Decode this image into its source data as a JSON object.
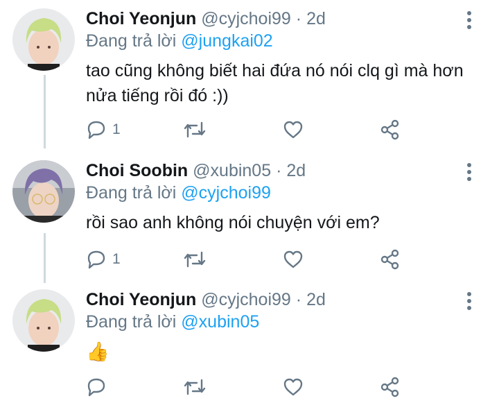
{
  "tweets": [
    {
      "name": "Choi Yeonjun",
      "handle": "@cyjchoi99",
      "separator": "·",
      "time": "2d",
      "reply_prefix": "Đang trả lời",
      "reply_to": "@jungkai02",
      "text": "tao cũng không biết hai đứa nó nói clq gì mà hơn nửa tiếng rồi đó :))",
      "reply_count": "1",
      "avatar_icon": "avatar-blonde"
    },
    {
      "name": "Choi Soobin",
      "handle": "@xubin05",
      "separator": "·",
      "time": "2d",
      "reply_prefix": "Đang trả lời",
      "reply_to": "@cyjchoi99",
      "text": "rồi sao anh không nói chuyện với em?",
      "reply_count": "1",
      "avatar_icon": "avatar-purple-hair"
    },
    {
      "name": "Choi Yeonjun",
      "handle": "@cyjchoi99",
      "separator": "·",
      "time": "2d",
      "reply_prefix": "Đang trả lời",
      "reply_to": "@xubin05",
      "text": "👍",
      "reply_count": "",
      "avatar_icon": "avatar-blonde"
    }
  ],
  "colors": {
    "link": "#1da1f2",
    "muted": "#657786",
    "thread_line": "#cfd9de",
    "text": "#14171a"
  }
}
